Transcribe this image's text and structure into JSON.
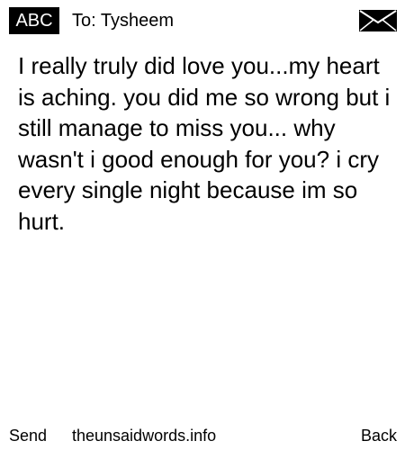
{
  "header": {
    "mode": "ABC",
    "recipient": "To: Tysheem",
    "status_icon": "envelope-icon"
  },
  "message": {
    "body": "I really truly did love you...my heart is aching. you did me so wrong but i still manage to miss you... why wasn't i good enough for you? i cry every single night because im so hurt."
  },
  "footer": {
    "send_label": "Send",
    "site": "theunsaidwords.info",
    "back_label": "Back"
  }
}
